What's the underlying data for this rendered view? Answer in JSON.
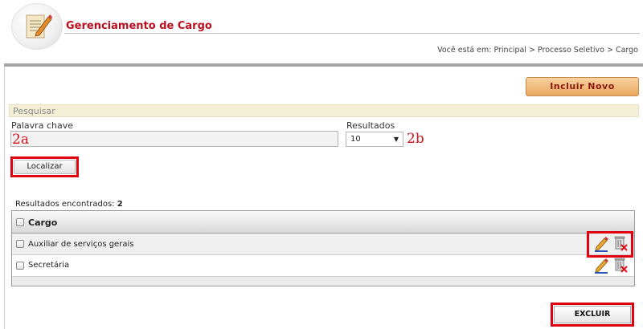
{
  "header": {
    "title": "Gerenciamento de Cargo",
    "breadcrumb": "Você está em: Principal > Processo Seletivo > Cargo",
    "logo_icon": "document-edit-icon"
  },
  "actions": {
    "include_label": "Incluir Novo"
  },
  "search": {
    "panel_title": "Pesquisar",
    "keyword_label": "Palavra chave",
    "keyword_value": "",
    "results_label": "Resultados",
    "results_selected": "10",
    "search_button": "Localizar",
    "annotation_keyword": "2a",
    "annotation_results": "2b"
  },
  "results": {
    "count_label": "Resultados encontrados:",
    "count": "2"
  },
  "table": {
    "column_header": "Cargo",
    "rows": [
      {
        "name": "Auxiliar de serviços gerais"
      },
      {
        "name": "Secretária"
      }
    ],
    "row_icons": [
      "pencil-edit-icon",
      "trash-delete-icon"
    ]
  },
  "footer": {
    "delete_label": "EXCLUIR"
  },
  "colors": {
    "title": "#b80f1f",
    "highlight_frame": "#e0000f",
    "include_button": "#e9a760"
  }
}
